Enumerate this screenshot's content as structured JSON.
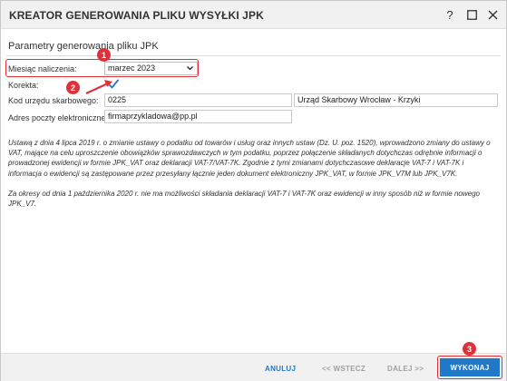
{
  "window": {
    "title": "KREATOR GENEROWANIA PLIKU WYSYŁKI JPK",
    "help_label": "?",
    "maximize_label": "☐",
    "close_label": "✕"
  },
  "section": {
    "title": "Parametry generowania pliku JPK"
  },
  "form": {
    "month_label": "Miesiąc naliczenia:",
    "month_value": "marzec 2023",
    "correction_label": "Korekta:",
    "correction_checked": true,
    "tax_office_label": "Kod urzędu skarbowego:",
    "tax_office_code": "0225",
    "tax_office_name": "Urząd Skarbowy Wrocław - Krzyki",
    "email_label": "Adres poczty elektronicznej:",
    "email_value": "firmaprzykladowa@pp.pl"
  },
  "info": {
    "paragraph1": "Ustawą z dnia 4 lipca 2019 r. o zmianie ustawy o podatku od towarów i usług oraz innych ustaw (Dz. U. poz. 1520), wprowadzono zmiany do ustawy o VAT, mające na celu uproszczenie obowiązków sprawozdawczych w tym podatku, poprzez połączenie składanych dotychczas odrębnie informacji o prowadzonej ewidencji w formie JPK_VAT oraz deklaracji VAT-7/VAT-7K. Zgodnie z tymi zmianami dotychczasowe deklaracje VAT-7 i VAT-7K i informacja o ewidencji są zastępowane przez przesyłany łącznie jeden dokument elektroniczny JPK_VAT, w formie JPK_V7M lub JPK_V7K.",
    "paragraph2": "Za okresy od dnia 1 października 2020 r. nie ma możliwości składania deklaracji VAT-7 i VAT-7K oraz ewidencji w inny sposób niż w formie nowego JPK_V7."
  },
  "footer": {
    "cancel_label": "ANULUJ",
    "back_label": "<< WSTECZ",
    "next_label": "DALEJ >>",
    "execute_label": "WYKONAJ"
  },
  "annotations": {
    "badge1": "1",
    "badge2": "2",
    "badge3": "3"
  },
  "colors": {
    "accent": "#1f78c8",
    "annotation": "#e0313a",
    "check": "#1f78c8"
  }
}
